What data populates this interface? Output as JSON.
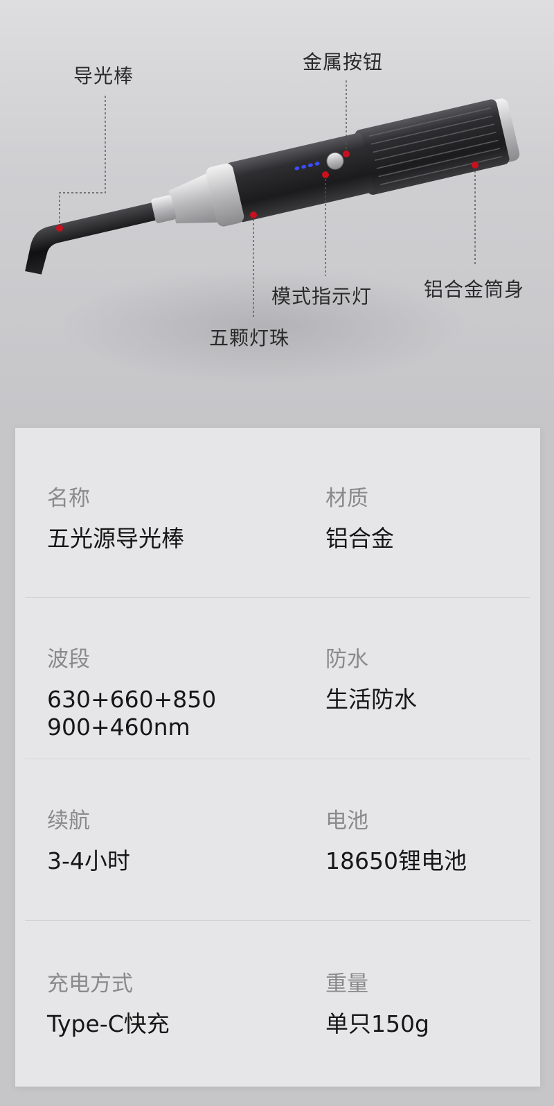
{
  "callouts": {
    "light_rod": "导光棒",
    "metal_button": "金属按钮",
    "mode_indicator": "模式指示灯",
    "aluminum_body": "铝合金筒身",
    "five_leds": "五颗灯珠"
  },
  "colors": {
    "marker_dot": "#c8101e",
    "indicator_led": "#2a3cff"
  },
  "specs": [
    {
      "left": {
        "label": "名称",
        "value": "五光源导光棒"
      },
      "right": {
        "label": "材质",
        "value": "铝合金"
      }
    },
    {
      "left": {
        "label": "波段",
        "value": "630+660+850",
        "value2": "900+460nm"
      },
      "right": {
        "label": "防水",
        "value": "生活防水"
      }
    },
    {
      "left": {
        "label": "续航",
        "value": "3-4小时"
      },
      "right": {
        "label": "电池",
        "value": "18650锂电池"
      }
    },
    {
      "left": {
        "label": "充电方式",
        "value": "Type-C快充"
      },
      "right": {
        "label": "重量",
        "value": "单只150g"
      }
    }
  ]
}
